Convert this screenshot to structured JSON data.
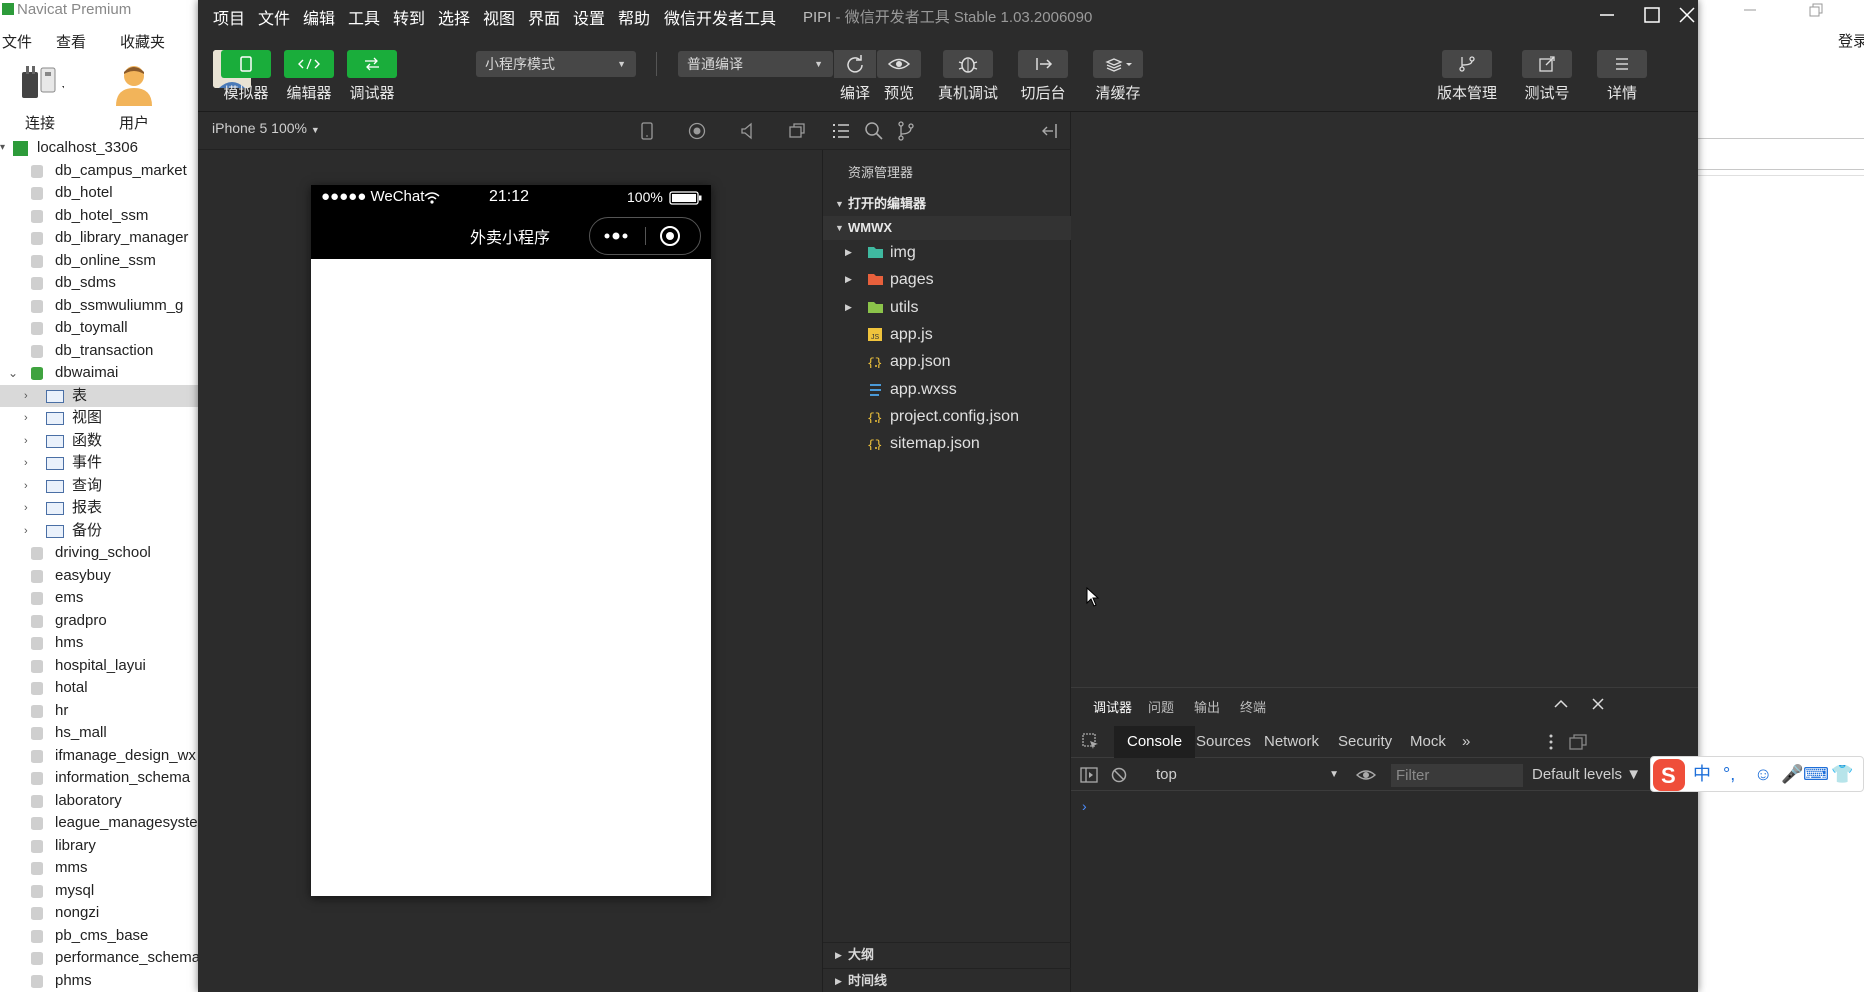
{
  "navicat": {
    "title": "Navicat Premium",
    "min_icon": "minimize-icon",
    "restore_icon": "restore-icon",
    "menu": [
      "文件",
      "查看",
      "收藏夹"
    ],
    "toolbar": [
      {
        "label": "连接",
        "icon": "plug-icon"
      },
      {
        "label": "用户",
        "icon": "user-icon"
      }
    ],
    "login": "登录",
    "connection": "localhost_3306",
    "databases_top": [
      "db_campus_market",
      "db_hotel",
      "db_hotel_ssm",
      "db_library_manager",
      "db_online_ssm",
      "db_sdms",
      "db_ssmwuliumm_g",
      "db_toymall",
      "db_transaction"
    ],
    "open_db": "dbwaimai",
    "objects": [
      "表",
      "视图",
      "函数",
      "事件",
      "查询",
      "报表",
      "备份"
    ],
    "databases_bottom": [
      "driving_school",
      "easybuy",
      "ems",
      "gradpro",
      "hms",
      "hospital_layui",
      "hotal",
      "hr",
      "hs_mall",
      "ifmanage_design_wx",
      "information_schema",
      "laboratory",
      "league_managesystem",
      "library",
      "mms",
      "mysql",
      "nongzi",
      "pb_cms_base",
      "performance_schema",
      "phms"
    ]
  },
  "wx": {
    "menu": [
      "项目",
      "文件",
      "编辑",
      "工具",
      "转到",
      "选择",
      "视图",
      "界面",
      "设置",
      "帮助",
      "微信开发者工具"
    ],
    "project_name": "PIPI",
    "title_suffix": " - 微信开发者工具 Stable 1.03.2006090",
    "toolbar": {
      "simulator": "模拟器",
      "editor": "编辑器",
      "debugger": "调试器",
      "mode_select": "小程序模式",
      "compile_select": "普通编译",
      "compile": "编译",
      "preview": "预览",
      "remote_debug": "真机调试",
      "background": "切后台",
      "clear_cache": "清缓存",
      "version": "版本管理",
      "test_account": "测试号",
      "details": "详情"
    },
    "sim": {
      "device": "iPhone 5 100%",
      "carrier": "●●●●● WeChat",
      "time": "21:12",
      "battery": "100%",
      "page_title": "外卖小程序"
    },
    "explorer": {
      "title": "资源管理器",
      "open_editors": "打开的编辑器",
      "project": "WMWX",
      "files": [
        {
          "name": "img",
          "type": "folder",
          "color": "#3fb9a0"
        },
        {
          "name": "pages",
          "type": "folder",
          "color": "#e8603c"
        },
        {
          "name": "utils",
          "type": "folder",
          "color": "#8bc34a"
        },
        {
          "name": "app.js",
          "type": "js",
          "color": "#f0c33c"
        },
        {
          "name": "app.json",
          "type": "json",
          "color": "#f0c33c"
        },
        {
          "name": "app.wxss",
          "type": "css",
          "color": "#4a9ad8"
        },
        {
          "name": "project.config.json",
          "type": "json",
          "color": "#f0c33c"
        },
        {
          "name": "sitemap.json",
          "type": "json",
          "color": "#f0c33c"
        }
      ],
      "outline": "大纲",
      "timeline": "时间线"
    },
    "debugger": {
      "panel_tabs": [
        "调试器",
        "问题",
        "输出",
        "终端"
      ],
      "devtools_tabs": [
        "Console",
        "Sources",
        "Network",
        "Security",
        "Mock"
      ],
      "more": "»",
      "context": "top",
      "filter_placeholder": "Filter",
      "levels": "Default levels ▼",
      "prompt": "›"
    }
  },
  "ime": {
    "items": [
      "中",
      "°,",
      "☺",
      "🎤",
      "⌨",
      "👕"
    ]
  },
  "colors": {
    "accent_green": "#1aad3b",
    "dark_bg": "#2c2c2c",
    "ime_blue": "#1e6fd9"
  }
}
